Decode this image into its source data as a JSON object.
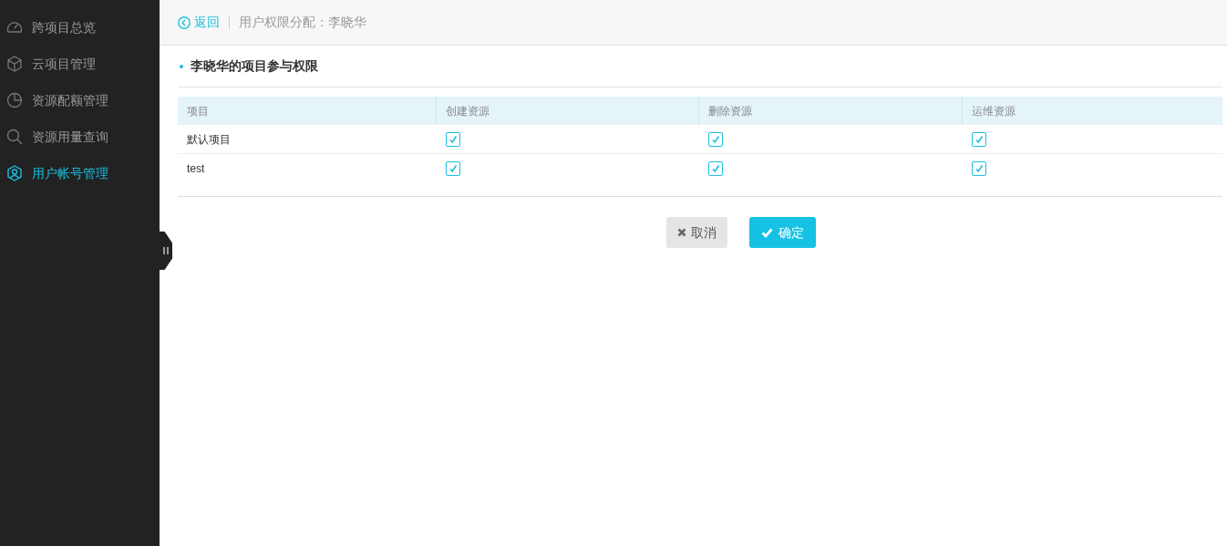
{
  "sidebar": {
    "items": [
      {
        "label": "跨项目总览",
        "selected": false
      },
      {
        "label": "云项目管理",
        "selected": false
      },
      {
        "label": "资源配额管理",
        "selected": false
      },
      {
        "label": "资源用量查询",
        "selected": false
      },
      {
        "label": "用户帐号管理",
        "selected": true
      }
    ]
  },
  "header": {
    "back": "返回",
    "title": "用户权限分配：李晓华"
  },
  "section_title": "李晓华的项目参与权限",
  "table": {
    "columns": [
      "项目",
      "创建资源",
      "删除资源",
      "运维资源"
    ],
    "rows": [
      {
        "project": "默认项目",
        "permissions": [
          {
            "checked": true
          },
          {
            "checked": true
          },
          {
            "checked": true
          }
        ]
      },
      {
        "project": "test",
        "permissions": [
          {
            "checked": true
          },
          {
            "checked": true
          },
          {
            "checked": true
          }
        ]
      }
    ]
  },
  "buttons": {
    "cancel": "取消",
    "confirm": "确定"
  }
}
